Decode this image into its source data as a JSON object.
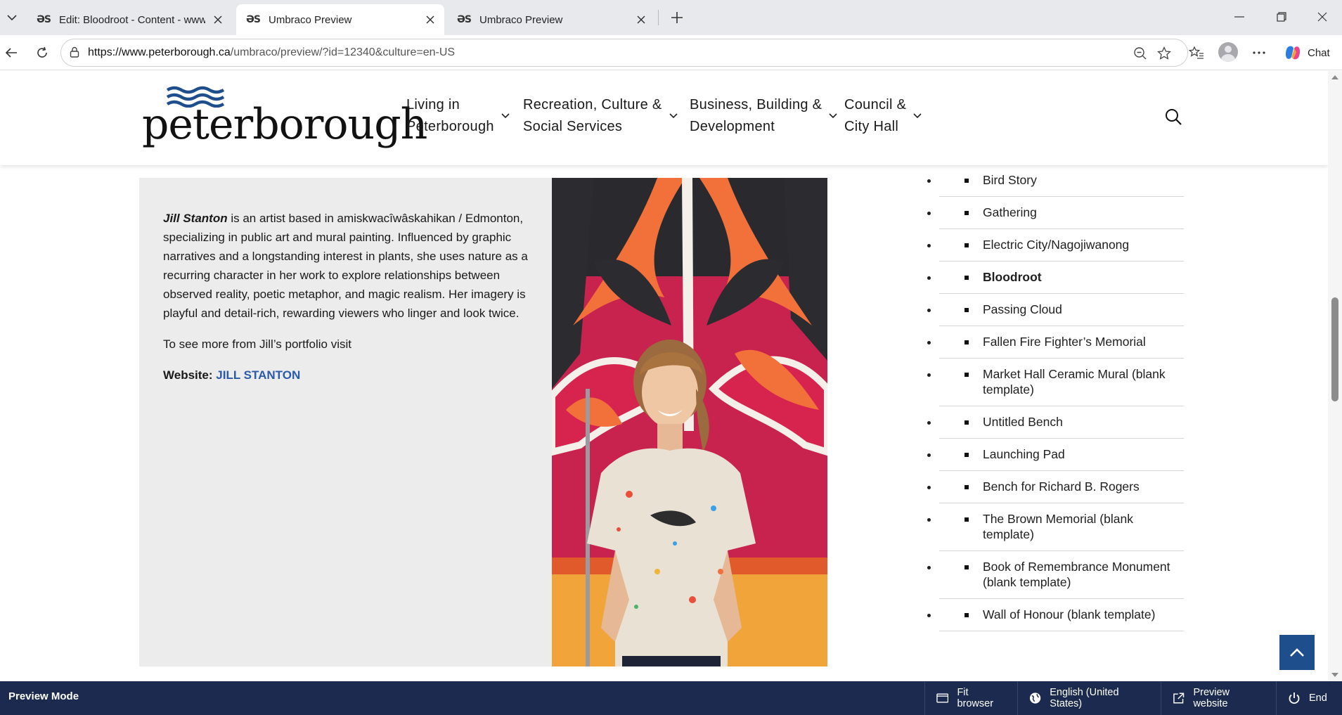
{
  "browser": {
    "tabs": [
      {
        "favicon": "ƏS",
        "title": "Edit: Bloodroot - Content - www.p",
        "active": false
      },
      {
        "favicon": "ƏS",
        "title": "Umbraco Preview",
        "active": true
      },
      {
        "favicon": "ƏS",
        "title": "Umbraco Preview",
        "active": false
      }
    ],
    "url_host": "https://www.peterborough.ca",
    "url_path": "/umbraco/preview/?id=12340&culture=en-US",
    "chat_label": "Chat",
    "icons": [
      "tab-list-icon",
      "close-icon",
      "new-tab-icon",
      "minimize-icon",
      "restore-icon",
      "window-close-icon",
      "back-icon",
      "reload-icon",
      "lock-icon",
      "zoom-out-icon",
      "star-icon",
      "favorites-icon",
      "profile-icon",
      "more-icon",
      "copilot-icon"
    ]
  },
  "site": {
    "logo_text": "peterborough",
    "nav": [
      {
        "label": "Living in\nPeterborough"
      },
      {
        "label": "Recreation, Culture &\nSocial Services"
      },
      {
        "label": "Business, Building &\nDevelopment"
      },
      {
        "label": "Council &\nCity Hall"
      }
    ],
    "brand_color": "#1f4e8c"
  },
  "artist": {
    "name": "Jill Stanton",
    "bio_rest": " is an artist based in amiskwacîwâskahikan / Edmonton, specializing in public art and mural painting. Influenced by graphic narratives and a longstanding interest in plants, she uses nature as a recurring character in her work to explore relationships between observed reality, poetic metaphor, and magic realism. Her imagery is playful and detail-rich, rewarding viewers who linger and look twice.",
    "portfolio_text": "To see more from Jill’s portfolio visit",
    "website_label": "Website:",
    "website_link": "JILL STANTON"
  },
  "art_list": {
    "items": [
      {
        "label": "Bird Story",
        "current": false
      },
      {
        "label": "Gathering",
        "current": false
      },
      {
        "label": "Electric City/Nagojiwanong",
        "current": false
      },
      {
        "label": "Bloodroot",
        "current": true
      },
      {
        "label": "Passing Cloud",
        "current": false
      },
      {
        "label": "Fallen Fire Fighter’s Memorial",
        "current": false
      },
      {
        "label": "Market Hall Ceramic Mural (blank template)",
        "current": false
      },
      {
        "label": "Untitled Bench",
        "current": false
      },
      {
        "label": "Launching Pad",
        "current": false
      },
      {
        "label": "Bench for Richard B. Rogers",
        "current": false
      },
      {
        "label": "The Brown Memorial (blank template)",
        "current": false
      },
      {
        "label": "Book of Remembrance Monument (blank template)",
        "current": false
      },
      {
        "label": "Wall of Honour (blank template)",
        "current": false
      }
    ]
  },
  "preview_bar": {
    "title": "Preview Mode",
    "fit_browser": "Fit browser",
    "language": "English (United States)",
    "preview_website": "Preview website",
    "end": "End"
  }
}
